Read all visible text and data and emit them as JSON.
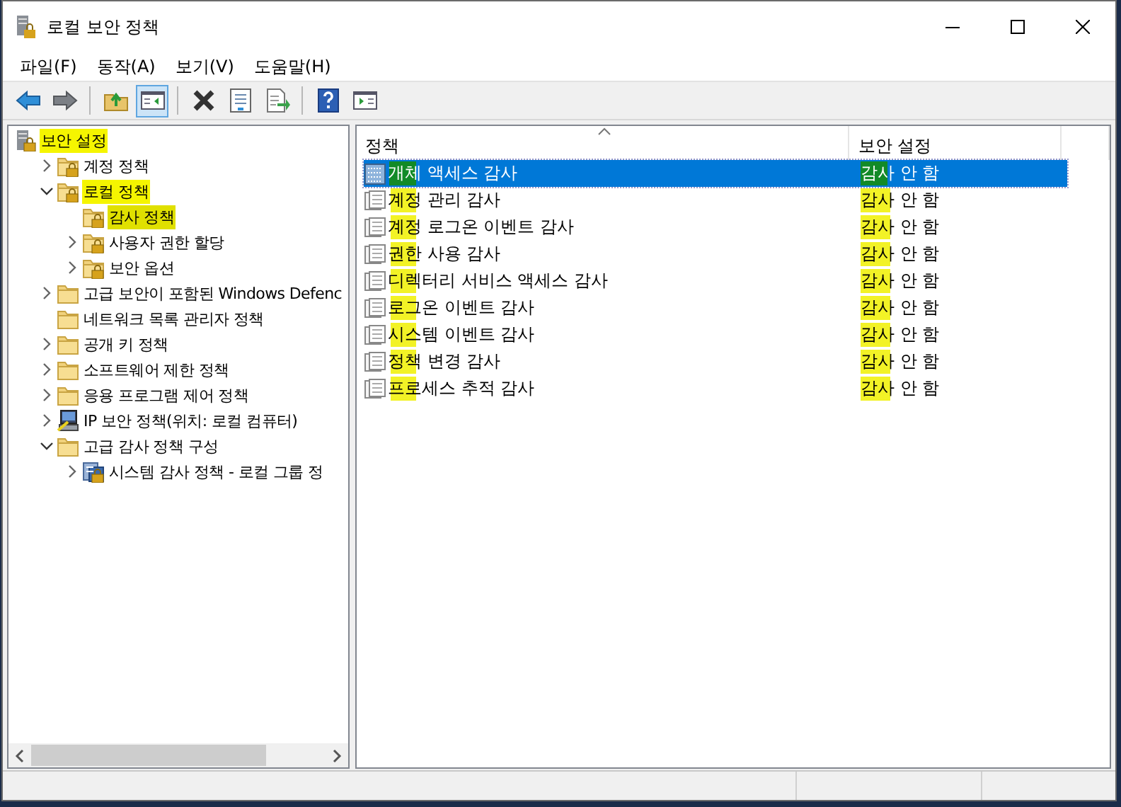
{
  "window": {
    "title": "로컬 보안 정책"
  },
  "menu": [
    "파일(F)",
    "동작(A)",
    "보기(V)",
    "도움말(H)"
  ],
  "toolbar": [
    {
      "kind": "back",
      "pressed": false
    },
    {
      "kind": "forward",
      "pressed": false
    },
    {
      "kind": "sep"
    },
    {
      "kind": "up",
      "pressed": false
    },
    {
      "kind": "tree",
      "pressed": true
    },
    {
      "kind": "sep"
    },
    {
      "kind": "delete",
      "pressed": false
    },
    {
      "kind": "properties",
      "pressed": false
    },
    {
      "kind": "export",
      "pressed": false
    },
    {
      "kind": "sep"
    },
    {
      "kind": "help",
      "pressed": false
    },
    {
      "kind": "pane",
      "pressed": false
    }
  ],
  "tree": [
    {
      "label": "보안 설정",
      "kind": "server",
      "selected": false,
      "highlighted": true,
      "children": [
        {
          "label": "계정 정책",
          "kind": "locked",
          "expanded": false,
          "selected": false,
          "highlighted": false
        },
        {
          "label": "로컬 정책",
          "kind": "locked",
          "expanded": true,
          "selected": false,
          "highlighted": true,
          "children": [
            {
              "label": "감사 정책",
              "kind": "locked",
              "selected": true,
              "highlighted": true
            },
            {
              "label": "사용자 권한 할당",
              "kind": "locked",
              "expanded": false,
              "selected": false,
              "highlighted": false
            },
            {
              "label": "보안 옵션",
              "kind": "locked",
              "expanded": false,
              "selected": false,
              "highlighted": false
            }
          ]
        },
        {
          "label": "고급 보안이 포함된 Windows Defenc",
          "kind": "folder",
          "expanded": false,
          "selected": false,
          "highlighted": false
        },
        {
          "label": "네트워크 목록 관리자 정책",
          "kind": "folder",
          "selected": false,
          "highlighted": false
        },
        {
          "label": "공개 키 정책",
          "kind": "folder",
          "expanded": false,
          "selected": false,
          "highlighted": false
        },
        {
          "label": "소프트웨어 제한 정책",
          "kind": "folder",
          "expanded": false,
          "selected": false,
          "highlighted": false
        },
        {
          "label": "응용 프로그램 제어 정책",
          "kind": "folder",
          "expanded": false,
          "selected": false,
          "highlighted": false
        },
        {
          "label": "IP 보안 정책(위치: 로컬 컴퓨터)",
          "kind": "computer",
          "expanded": false,
          "selected": false,
          "highlighted": false
        },
        {
          "label": "고급 감사 정책 구성",
          "kind": "folder",
          "expanded": true,
          "selected": false,
          "highlighted": false,
          "children": [
            {
              "label": "시스템 감사 정책 - 로컬 그룹 정",
              "kind": "policy",
              "expanded": false,
              "selected": false,
              "highlighted": false
            }
          ]
        }
      ]
    }
  ],
  "table": {
    "columns": [
      "정책",
      "보안 설정"
    ],
    "rows": [
      {
        "name": "개체 액세스 감사",
        "setting": "감사 안 함",
        "selected": true,
        "marked": true
      },
      {
        "name": "계정 관리 감사",
        "setting": "감사 안 함",
        "selected": false,
        "marked": true
      },
      {
        "name": "계정 로그온 이벤트 감사",
        "setting": "감사 안 함",
        "selected": false,
        "marked": true
      },
      {
        "name": "권한 사용 감사",
        "setting": "감사 안 함",
        "selected": false,
        "marked": true
      },
      {
        "name": "디렉터리 서비스 액세스 감사",
        "setting": "감사 안 함",
        "selected": false,
        "marked": true
      },
      {
        "name": "로그온 이벤트 감사",
        "setting": "감사 안 함",
        "selected": false,
        "marked": true
      },
      {
        "name": "시스템 이벤트 감사",
        "setting": "감사 안 함",
        "selected": false,
        "marked": true
      },
      {
        "name": "정책 변경 감사",
        "setting": "감사 안 함",
        "selected": false,
        "marked": true
      },
      {
        "name": "프로세스 추적 감사",
        "setting": "감사 안 함",
        "selected": false,
        "marked": true
      }
    ]
  }
}
